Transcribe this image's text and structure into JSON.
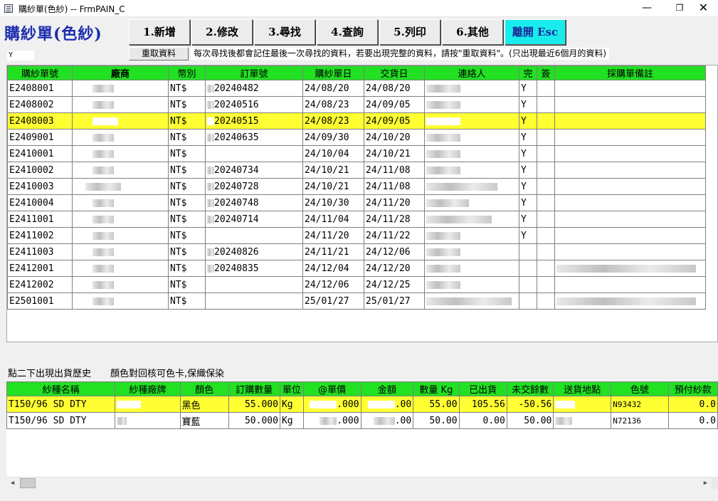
{
  "window": {
    "title": "購紗單(色紗)  --  FrmPAIN_C",
    "min": "—",
    "max": "❐",
    "close": "✕"
  },
  "form_title": "購紗單(色紗)",
  "toolbar": [
    "1.新增",
    "2.修改",
    "3.尋找",
    "4.查詢",
    "5.列印",
    "6.其他",
    "離開 Esc"
  ],
  "small_input": "Y",
  "reload_label": "重取資料",
  "hint": "每次尋找後都會記住最後一次尋找的資料，若要出現完整的資料，請按\"重取資料\"。(只出現最近6個月的資料)",
  "orders": {
    "headers": [
      "購紗單號",
      "廠商",
      "幣別",
      "訂單號",
      "購紗單日",
      "交貨日",
      "連絡人",
      "完",
      "簽",
      "採購單備註"
    ],
    "rows": [
      {
        "no": "E2408001",
        "cur": "NT$",
        "order": "20240482",
        "buy": "24/08/20",
        "ship": "24/08/20",
        "done": "Y"
      },
      {
        "no": "E2408002",
        "cur": "NT$",
        "order": "20240516",
        "buy": "24/08/23",
        "ship": "24/09/05",
        "done": "Y"
      },
      {
        "no": "E2408003",
        "cur": "NT$",
        "order": "20240515",
        "buy": "24/08/23",
        "ship": "24/09/05",
        "done": "Y"
      },
      {
        "no": "E2409001",
        "cur": "NT$",
        "order": "20240635",
        "buy": "24/09/30",
        "ship": "24/10/20",
        "done": "Y"
      },
      {
        "no": "E2410001",
        "cur": "NT$",
        "order": "",
        "buy": "24/10/04",
        "ship": "24/10/21",
        "done": "Y"
      },
      {
        "no": "E2410002",
        "cur": "NT$",
        "order": "20240734",
        "buy": "24/10/21",
        "ship": "24/11/08",
        "done": "Y"
      },
      {
        "no": "E2410003",
        "cur": "NT$",
        "order": "20240728",
        "buy": "24/10/21",
        "ship": "24/11/08",
        "done": "Y"
      },
      {
        "no": "E2410004",
        "cur": "NT$",
        "order": "20240748",
        "buy": "24/10/30",
        "ship": "24/11/20",
        "done": "Y"
      },
      {
        "no": "E2411001",
        "cur": "NT$",
        "order": "20240714",
        "buy": "24/11/04",
        "ship": "24/11/28",
        "done": "Y"
      },
      {
        "no": "E2411002",
        "cur": "NT$",
        "order": "",
        "buy": "24/11/20",
        "ship": "24/11/22",
        "done": "Y"
      },
      {
        "no": "E2411003",
        "cur": "NT$",
        "order": "20240826",
        "buy": "24/11/21",
        "ship": "24/12/06",
        "done": ""
      },
      {
        "no": "E2412001",
        "cur": "NT$",
        "order": "20240835",
        "buy": "24/12/04",
        "ship": "24/12/20",
        "done": ""
      },
      {
        "no": "E2412002",
        "cur": "NT$",
        "order": "",
        "buy": "24/12/06",
        "ship": "24/12/25",
        "done": ""
      },
      {
        "no": "E2501001",
        "cur": "NT$",
        "order": "",
        "buy": "25/01/27",
        "ship": "25/01/27",
        "done": ""
      }
    ]
  },
  "label_history": "點二下出現出貨歷史",
  "label_note": "顏色對回核可色卡,保織保染",
  "details": {
    "headers": [
      "紗種名稱",
      "紗種廠牌",
      "顏色",
      "訂購數量",
      "單位",
      "@單價",
      "金額",
      "數量 Kg",
      "已出貨",
      "未交餘數",
      "送貨地點",
      "色號",
      "預付紗款"
    ],
    "rows": [
      {
        "yarn": "T150/96 SD DTY",
        "color": "黑色",
        "qty": "55.000",
        "unit": "Kg",
        "price": ".000",
        "amount": ".00",
        "kg": "55.00",
        "shipped": "105.56",
        "remain": "-50.56",
        "code": "N93432",
        "prepay": "0.0"
      },
      {
        "yarn": "T150/96 SD DTY",
        "color": "寶藍",
        "qty": "50.000",
        "unit": "Kg",
        "price": ".000",
        "amount": ".00",
        "kg": "50.00",
        "shipped": "0.00",
        "remain": "50.00",
        "code": "N72136",
        "prepay": "0.0"
      }
    ]
  },
  "scroll": {
    "left": "◀",
    "right": "▶"
  },
  "colors": {
    "header_green": "#22e022",
    "selected_yellow": "#ffff33",
    "title_blue": "#1c2db0",
    "exit_cyan": "#19ecec"
  },
  "icons": [
    "app-icon",
    "minimize-icon",
    "maximize-icon",
    "close-icon",
    "scroll-left-icon",
    "scroll-right-icon"
  ]
}
